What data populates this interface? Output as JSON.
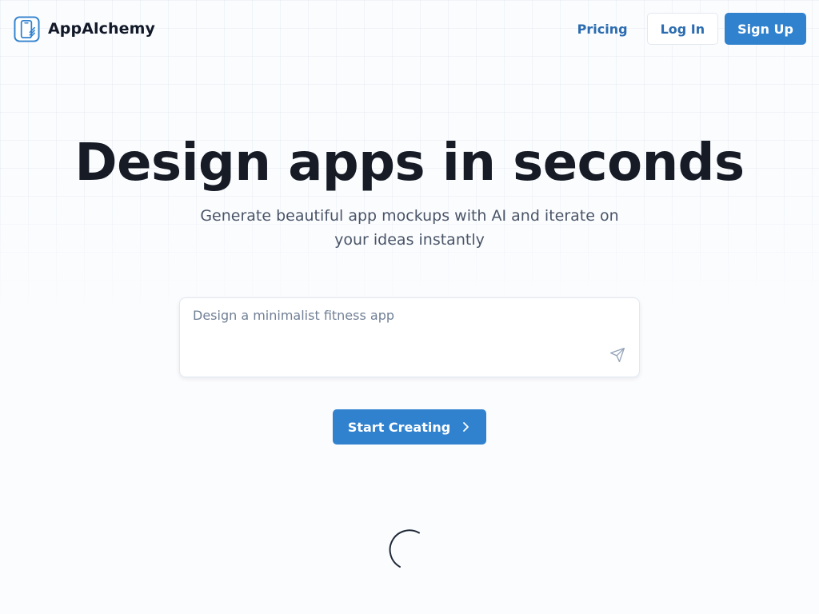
{
  "app": {
    "name": "AppAlchemy",
    "logo_icon": "phone-wand-icon"
  },
  "nav": {
    "pricing_label": "Pricing",
    "login_label": "Log In",
    "signup_label": "Sign Up"
  },
  "hero": {
    "title": "Design apps in seconds",
    "subtitle": "Generate beautiful app mockups with AI and iterate on your ideas instantly"
  },
  "prompt": {
    "value": "",
    "placeholder": "Design a minimalist fitness app",
    "send_icon": "send-icon"
  },
  "cta": {
    "label": "Start Creating",
    "icon": "chevron-right-icon"
  },
  "loading": {
    "icon": "spinner-icon"
  },
  "colors": {
    "accent": "#3182ce",
    "link": "#2b6cb0",
    "heading": "#161b26",
    "muted": "#4a5568",
    "background": "#fbfcfe"
  }
}
